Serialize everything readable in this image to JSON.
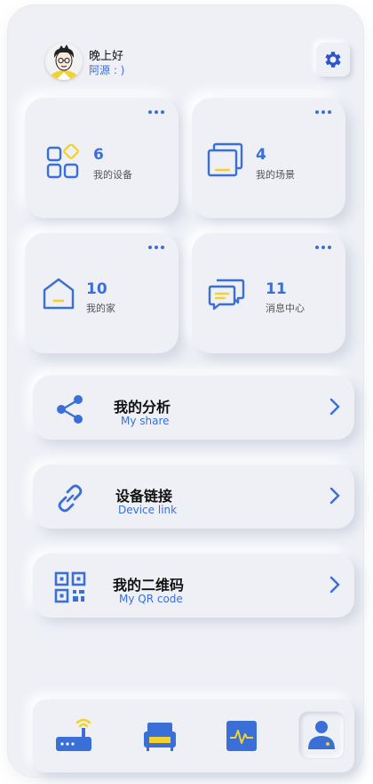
{
  "header": {
    "greeting": "晚上好",
    "username": "阿源 : )"
  },
  "cards": [
    {
      "count": "6",
      "label": "我的设备",
      "icon": "devices-grid-icon"
    },
    {
      "count": "4",
      "label": "我的场景",
      "icon": "scene-windows-icon"
    },
    {
      "count": "10",
      "label": "我的家",
      "icon": "home-icon"
    },
    {
      "count": "11",
      "label": "消息中心",
      "icon": "chat-bubbles-icon"
    }
  ],
  "rows": [
    {
      "title": "我的分析",
      "subtitle": "My share",
      "icon": "share-icon"
    },
    {
      "title": "设备链接",
      "subtitle": "Device link",
      "icon": "link-icon"
    },
    {
      "title": "我的二维码",
      "subtitle": "My QR code",
      "icon": "qr-code-icon"
    }
  ],
  "tabs": [
    {
      "icon": "router-wifi-icon"
    },
    {
      "icon": "sofa-icon"
    },
    {
      "icon": "activity-monitor-icon"
    },
    {
      "icon": "user-profile-icon",
      "active": true
    }
  ],
  "colors": {
    "accent": "#3a6fd8",
    "highlight": "#f2d22e",
    "background": "#eef0f6"
  }
}
